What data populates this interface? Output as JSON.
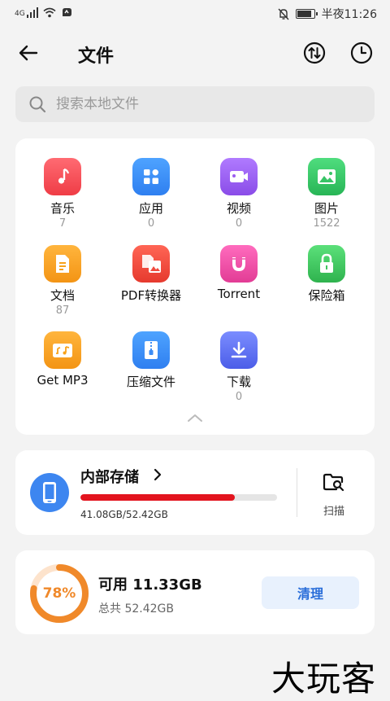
{
  "status_bar": {
    "network": "4G",
    "time_text": "半夜11:26"
  },
  "header": {
    "title": "文件",
    "icons": [
      "back-arrow-icon",
      "sort-icon",
      "history-clock-icon"
    ]
  },
  "search": {
    "placeholder": "搜索本地文件"
  },
  "categories": [
    {
      "label": "音乐",
      "count": "7",
      "icon": "music-icon",
      "color": "#f2545b"
    },
    {
      "label": "应用",
      "count": "0",
      "icon": "apps-icon",
      "color": "#3d8df5"
    },
    {
      "label": "视频",
      "count": "0",
      "icon": "video-icon",
      "color": "#9b5cf0"
    },
    {
      "label": "图片",
      "count": "1522",
      "icon": "image-icon",
      "color": "#37c466"
    },
    {
      "label": "文档",
      "count": "87",
      "icon": "document-icon",
      "color": "#f7a21b"
    },
    {
      "label": "PDF转换器",
      "count": "",
      "icon": "pdf-converter-icon",
      "color": "#f04a3e"
    },
    {
      "label": "Torrent",
      "count": "",
      "icon": "magnet-icon",
      "color": "#ec4fa3"
    },
    {
      "label": "保险箱",
      "count": "",
      "icon": "lock-icon",
      "color": "#3fc45e"
    },
    {
      "label": "Get MP3",
      "count": "",
      "icon": "mp3-icon",
      "color": "#f7a21b"
    },
    {
      "label": "压缩文件",
      "count": "",
      "icon": "zip-icon",
      "color": "#3d8df5"
    },
    {
      "label": "下载",
      "count": "0",
      "icon": "download-icon",
      "color": "#5b6ff0"
    }
  ],
  "storage": {
    "title": "内部存储",
    "used_text": "41.08GB/52.42GB",
    "used_fraction": 0.784,
    "scan_label": "扫描"
  },
  "available": {
    "percent_text": "78%",
    "percent": 78,
    "title": "可用 11.33GB",
    "total_text": "总共 52.42GB",
    "clean_label": "清理"
  },
  "watermark": "大玩客"
}
